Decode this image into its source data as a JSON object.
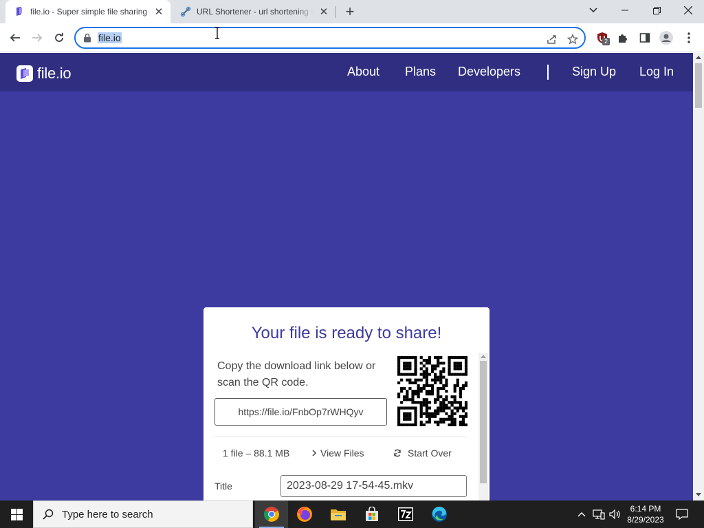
{
  "browser": {
    "tabs": [
      {
        "title": "file.io - Super simple file sharing",
        "active": true
      },
      {
        "title": "URL Shortener - url shortening se",
        "active": false
      }
    ],
    "url": "file.io",
    "extension_badge": "2"
  },
  "site": {
    "logo": "file.io",
    "nav": {
      "about": "About",
      "plans": "Plans",
      "developers": "Developers",
      "signup": "Sign Up",
      "login": "Log In"
    },
    "card": {
      "heading": "Your file is ready to share!",
      "description": "Copy the download link below or scan the QR code.",
      "download_link": "https://file.io/FnbOp7rWHQyv",
      "file_info": "1 file – 88.1 MB",
      "view_files": "View Files",
      "start_over": "Start Over",
      "title_label": "Title",
      "title_value": "2023-08-29 17-54-45.mkv"
    }
  },
  "taskbar": {
    "search_placeholder": "Type here to search",
    "time": "6:14 PM",
    "date": "8/29/2023"
  },
  "colors": {
    "page_background": "#3d3aa0",
    "nav_background": "#302e80",
    "heading": "#3d3aa0",
    "omnibox_focus": "#1a73e8"
  }
}
